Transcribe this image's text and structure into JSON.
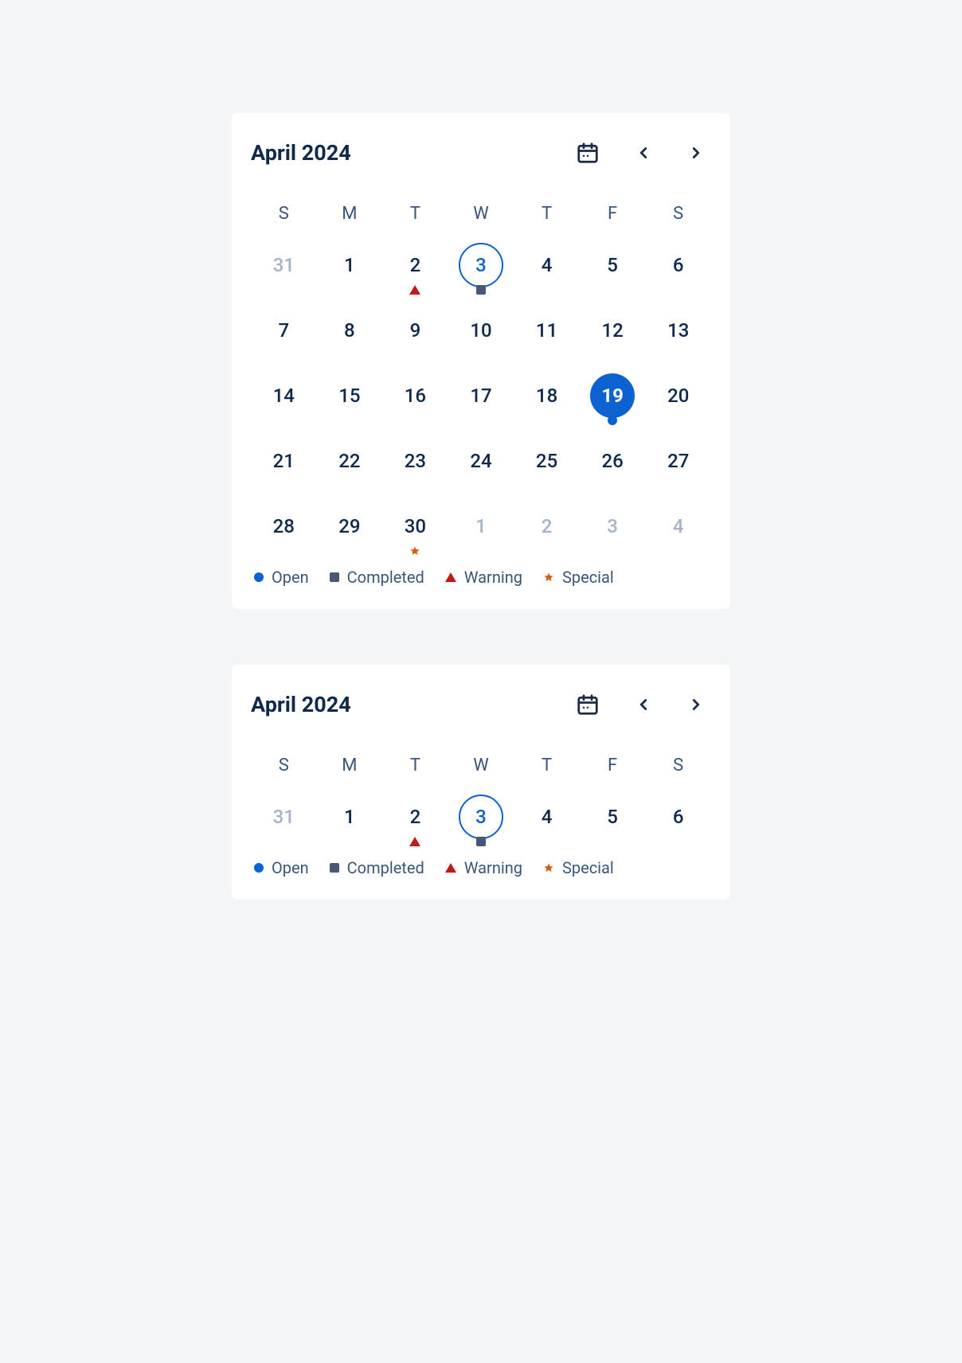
{
  "calendars": [
    {
      "title": "April 2024",
      "weekdays": [
        "S",
        "M",
        "T",
        "W",
        "T",
        "F",
        "S"
      ],
      "weeks": [
        [
          {
            "day": "31",
            "dim": true
          },
          {
            "day": "1"
          },
          {
            "day": "2",
            "marker": "triangle"
          },
          {
            "day": "3",
            "today": true,
            "marker": "square"
          },
          {
            "day": "4"
          },
          {
            "day": "5"
          },
          {
            "day": "6"
          }
        ],
        [
          {
            "day": "7"
          },
          {
            "day": "8"
          },
          {
            "day": "9"
          },
          {
            "day": "10"
          },
          {
            "day": "11"
          },
          {
            "day": "12"
          },
          {
            "day": "13"
          }
        ],
        [
          {
            "day": "14"
          },
          {
            "day": "15"
          },
          {
            "day": "16"
          },
          {
            "day": "17"
          },
          {
            "day": "18"
          },
          {
            "day": "19",
            "selected": true,
            "marker": "circle"
          },
          {
            "day": "20"
          }
        ],
        [
          {
            "day": "21"
          },
          {
            "day": "22"
          },
          {
            "day": "23"
          },
          {
            "day": "24"
          },
          {
            "day": "25"
          },
          {
            "day": "26"
          },
          {
            "day": "27"
          }
        ],
        [
          {
            "day": "28"
          },
          {
            "day": "29"
          },
          {
            "day": "30",
            "marker": "star"
          },
          {
            "day": "1",
            "dim": true
          },
          {
            "day": "2",
            "dim": true
          },
          {
            "day": "3",
            "dim": true
          },
          {
            "day": "4",
            "dim": true
          }
        ]
      ],
      "legend": [
        {
          "label": "Open",
          "shape": "circle"
        },
        {
          "label": "Completed",
          "shape": "square"
        },
        {
          "label": "Warning",
          "shape": "triangle"
        },
        {
          "label": "Special",
          "shape": "star"
        }
      ]
    },
    {
      "title": "April 2024",
      "weekdays": [
        "S",
        "M",
        "T",
        "W",
        "T",
        "F",
        "S"
      ],
      "weeks": [
        [
          {
            "day": "31",
            "dim": true
          },
          {
            "day": "1"
          },
          {
            "day": "2",
            "marker": "triangle"
          },
          {
            "day": "3",
            "today": true,
            "marker": "square"
          },
          {
            "day": "4"
          },
          {
            "day": "5"
          },
          {
            "day": "6"
          }
        ]
      ],
      "legend": [
        {
          "label": "Open",
          "shape": "circle"
        },
        {
          "label": "Completed",
          "shape": "square"
        },
        {
          "label": "Warning",
          "shape": "triangle"
        },
        {
          "label": "Special",
          "shape": "star"
        }
      ]
    }
  ]
}
